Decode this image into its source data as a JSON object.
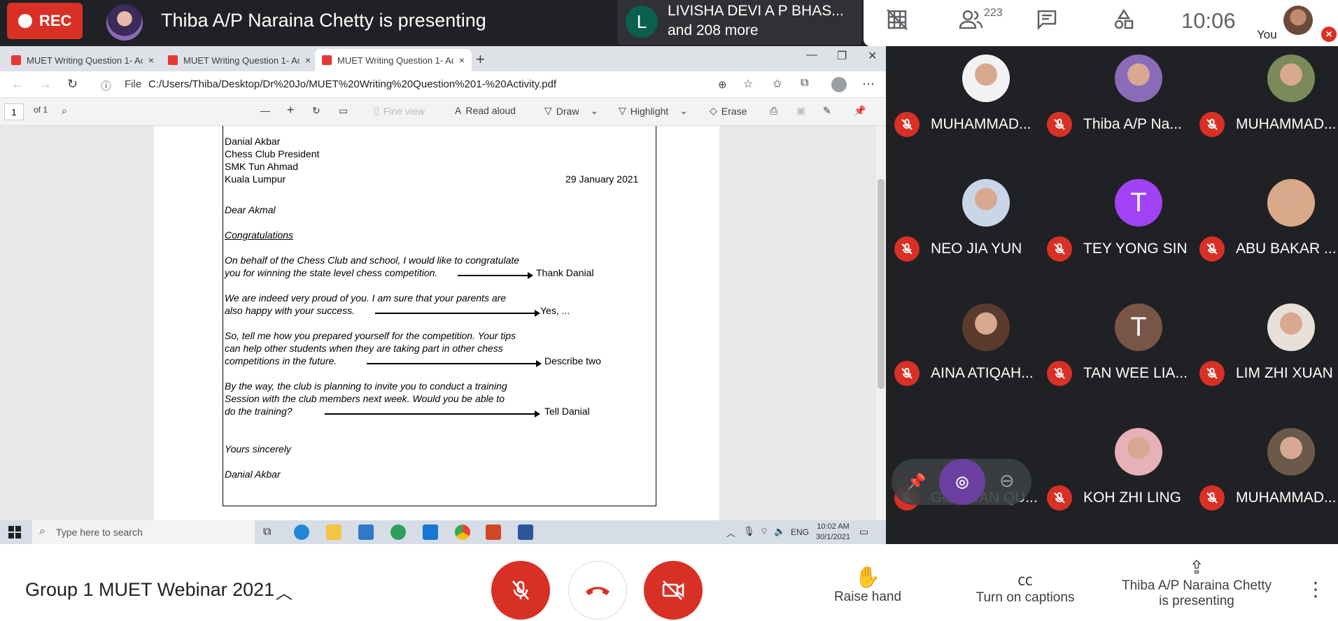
{
  "topbar": {
    "rec_label": "REC",
    "presenting_title": "Thiba A/P Naraina Chetty is presenting",
    "joiners": {
      "initial": "L",
      "line1": "LIVISHA DEVI A P BHAS...",
      "line2": "and 208 more"
    },
    "people_count": "223",
    "clock": "10:06",
    "you_label": "You"
  },
  "browser": {
    "tabs": [
      {
        "title": "MUET Writing Question 1- Activi",
        "close": "×"
      },
      {
        "title": "MUET Writing Question 1- Activi",
        "close": "×"
      },
      {
        "title": "MUET Writing Question 1- Activi",
        "close": "×"
      }
    ],
    "new_tab": "+",
    "file_label": "File",
    "url": "C:/Users/Thiba/Desktop/Dr%20Jo/MUET%20Writing%20Question%201-%20Activity.pdf"
  },
  "pdf_toolbar": {
    "page_number": "1",
    "page_total": "of 1",
    "fit_view": "Fine view",
    "read_aloud": "Read aloud",
    "draw": "Draw",
    "highlight": "Highlight",
    "erase": "Erase"
  },
  "letter": {
    "address_lines": [
      "Danial Akbar",
      "Chess Club President",
      "SMK Tun Ahmad",
      "Kuala Lumpur"
    ],
    "date": "29 January 2021",
    "salutation": "Dear Akmal",
    "subject": "Congratulations",
    "paragraphs": [
      {
        "lines": [
          "On behalf of the Chess Club and school, I would like to congratulate",
          "you for winning the state level chess competition."
        ],
        "note": "Thank Danial"
      },
      {
        "lines": [
          "We are indeed very proud of you. I am sure that your parents are",
          "also happy with your success."
        ],
        "note": "Yes, ..."
      },
      {
        "lines": [
          "So, tell me how you prepared yourself for the competition.  Your tips",
          "can help other students when they are taking part in other chess",
          "competitions in the future."
        ],
        "note": "Describe two"
      },
      {
        "lines": [
          "By the way, the club is planning to invite you to conduct a training",
          "Session with the club members next week.  Would you be able to",
          "do the training?"
        ],
        "note": "Tell Danial"
      }
    ],
    "closing": "Yours sincerely",
    "signature": "Danial Akbar"
  },
  "taskbar": {
    "search_placeholder": "Type here to search",
    "lang": "ENG",
    "time": "10:02 AM",
    "date": "30/1/2021"
  },
  "participants": [
    {
      "name": "MUHAMMAD...",
      "avatar": "photo",
      "color": "#f2f2f2"
    },
    {
      "name": "Thiba A/P Na...",
      "avatar": "photo",
      "color": "#8a6bb8"
    },
    {
      "name": "MUHAMMAD...",
      "avatar": "photo",
      "color": "#7a8a5a"
    },
    {
      "name": "NEO JIA YUN",
      "avatar": "photo",
      "color": "#c9d6e8"
    },
    {
      "name": "TEY YONG SIN",
      "avatar": "T",
      "color": "#a142f4"
    },
    {
      "name": "ABU BAKAR ...",
      "avatar": "photo",
      "color": "#d9a98a"
    },
    {
      "name": "AINA ATIQAH...",
      "avatar": "photo",
      "color": "#5a3b2e"
    },
    {
      "name": "TAN WEE LIA...",
      "avatar": "T",
      "color": "#795548"
    },
    {
      "name": "LIM ZHI XUAN",
      "avatar": "photo",
      "color": "#e8e0d8"
    },
    {
      "name": "GOH HAN QU...",
      "avatar": "photo",
      "color": "#6a3fa0"
    },
    {
      "name": "KOH ZHI LING",
      "avatar": "photo",
      "color": "#e8b0b8"
    },
    {
      "name": "MUHAMMAD...",
      "avatar": "photo",
      "color": "#6b5a4a"
    }
  ],
  "bottombar": {
    "meeting_title": "Group 1 MUET Webinar 2021",
    "raise_hand": "Raise hand",
    "captions": "Turn on captions",
    "presenting_line1": "Thiba A/P Naraina Chetty",
    "presenting_line2": "is presenting"
  },
  "colors": {
    "danger": "#d93025",
    "dark": "#202124",
    "accent": "#1a73e8"
  }
}
